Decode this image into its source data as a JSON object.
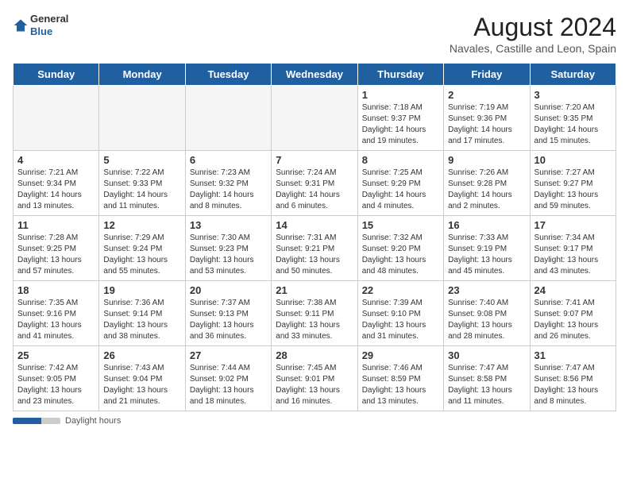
{
  "header": {
    "logo_general": "General",
    "logo_blue": "Blue",
    "main_title": "August 2024",
    "sub_title": "Navales, Castille and Leon, Spain"
  },
  "days_of_week": [
    "Sunday",
    "Monday",
    "Tuesday",
    "Wednesday",
    "Thursday",
    "Friday",
    "Saturday"
  ],
  "footer": {
    "label": "Daylight hours"
  },
  "weeks": [
    [
      {
        "day": "",
        "info": ""
      },
      {
        "day": "",
        "info": ""
      },
      {
        "day": "",
        "info": ""
      },
      {
        "day": "",
        "info": ""
      },
      {
        "day": "1",
        "info": "Sunrise: 7:18 AM\nSunset: 9:37 PM\nDaylight: 14 hours\nand 19 minutes."
      },
      {
        "day": "2",
        "info": "Sunrise: 7:19 AM\nSunset: 9:36 PM\nDaylight: 14 hours\nand 17 minutes."
      },
      {
        "day": "3",
        "info": "Sunrise: 7:20 AM\nSunset: 9:35 PM\nDaylight: 14 hours\nand 15 minutes."
      }
    ],
    [
      {
        "day": "4",
        "info": "Sunrise: 7:21 AM\nSunset: 9:34 PM\nDaylight: 14 hours\nand 13 minutes."
      },
      {
        "day": "5",
        "info": "Sunrise: 7:22 AM\nSunset: 9:33 PM\nDaylight: 14 hours\nand 11 minutes."
      },
      {
        "day": "6",
        "info": "Sunrise: 7:23 AM\nSunset: 9:32 PM\nDaylight: 14 hours\nand 8 minutes."
      },
      {
        "day": "7",
        "info": "Sunrise: 7:24 AM\nSunset: 9:31 PM\nDaylight: 14 hours\nand 6 minutes."
      },
      {
        "day": "8",
        "info": "Sunrise: 7:25 AM\nSunset: 9:29 PM\nDaylight: 14 hours\nand 4 minutes."
      },
      {
        "day": "9",
        "info": "Sunrise: 7:26 AM\nSunset: 9:28 PM\nDaylight: 14 hours\nand 2 minutes."
      },
      {
        "day": "10",
        "info": "Sunrise: 7:27 AM\nSunset: 9:27 PM\nDaylight: 13 hours\nand 59 minutes."
      }
    ],
    [
      {
        "day": "11",
        "info": "Sunrise: 7:28 AM\nSunset: 9:25 PM\nDaylight: 13 hours\nand 57 minutes."
      },
      {
        "day": "12",
        "info": "Sunrise: 7:29 AM\nSunset: 9:24 PM\nDaylight: 13 hours\nand 55 minutes."
      },
      {
        "day": "13",
        "info": "Sunrise: 7:30 AM\nSunset: 9:23 PM\nDaylight: 13 hours\nand 53 minutes."
      },
      {
        "day": "14",
        "info": "Sunrise: 7:31 AM\nSunset: 9:21 PM\nDaylight: 13 hours\nand 50 minutes."
      },
      {
        "day": "15",
        "info": "Sunrise: 7:32 AM\nSunset: 9:20 PM\nDaylight: 13 hours\nand 48 minutes."
      },
      {
        "day": "16",
        "info": "Sunrise: 7:33 AM\nSunset: 9:19 PM\nDaylight: 13 hours\nand 45 minutes."
      },
      {
        "day": "17",
        "info": "Sunrise: 7:34 AM\nSunset: 9:17 PM\nDaylight: 13 hours\nand 43 minutes."
      }
    ],
    [
      {
        "day": "18",
        "info": "Sunrise: 7:35 AM\nSunset: 9:16 PM\nDaylight: 13 hours\nand 41 minutes."
      },
      {
        "day": "19",
        "info": "Sunrise: 7:36 AM\nSunset: 9:14 PM\nDaylight: 13 hours\nand 38 minutes."
      },
      {
        "day": "20",
        "info": "Sunrise: 7:37 AM\nSunset: 9:13 PM\nDaylight: 13 hours\nand 36 minutes."
      },
      {
        "day": "21",
        "info": "Sunrise: 7:38 AM\nSunset: 9:11 PM\nDaylight: 13 hours\nand 33 minutes."
      },
      {
        "day": "22",
        "info": "Sunrise: 7:39 AM\nSunset: 9:10 PM\nDaylight: 13 hours\nand 31 minutes."
      },
      {
        "day": "23",
        "info": "Sunrise: 7:40 AM\nSunset: 9:08 PM\nDaylight: 13 hours\nand 28 minutes."
      },
      {
        "day": "24",
        "info": "Sunrise: 7:41 AM\nSunset: 9:07 PM\nDaylight: 13 hours\nand 26 minutes."
      }
    ],
    [
      {
        "day": "25",
        "info": "Sunrise: 7:42 AM\nSunset: 9:05 PM\nDaylight: 13 hours\nand 23 minutes."
      },
      {
        "day": "26",
        "info": "Sunrise: 7:43 AM\nSunset: 9:04 PM\nDaylight: 13 hours\nand 21 minutes."
      },
      {
        "day": "27",
        "info": "Sunrise: 7:44 AM\nSunset: 9:02 PM\nDaylight: 13 hours\nand 18 minutes."
      },
      {
        "day": "28",
        "info": "Sunrise: 7:45 AM\nSunset: 9:01 PM\nDaylight: 13 hours\nand 16 minutes."
      },
      {
        "day": "29",
        "info": "Sunrise: 7:46 AM\nSunset: 8:59 PM\nDaylight: 13 hours\nand 13 minutes."
      },
      {
        "day": "30",
        "info": "Sunrise: 7:47 AM\nSunset: 8:58 PM\nDaylight: 13 hours\nand 11 minutes."
      },
      {
        "day": "31",
        "info": "Sunrise: 7:47 AM\nSunset: 8:56 PM\nDaylight: 13 hours\nand 8 minutes."
      }
    ]
  ]
}
